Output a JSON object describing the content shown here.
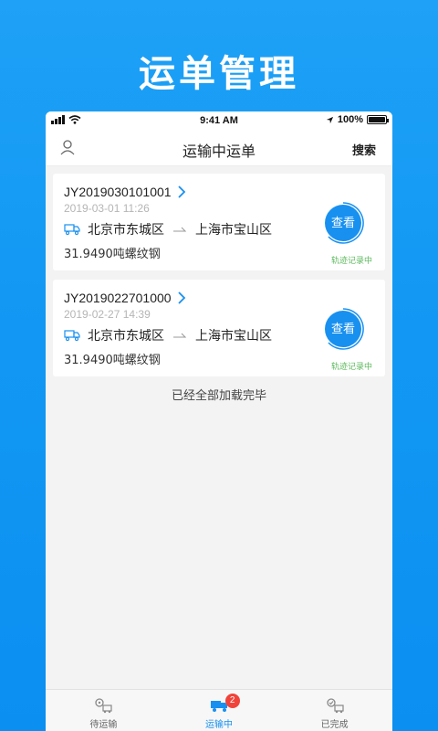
{
  "promo": {
    "title": "运单管理"
  },
  "status_bar": {
    "time": "9:41 AM",
    "battery": "100%"
  },
  "nav": {
    "title": "运输中运单",
    "search_label": "搜索"
  },
  "orders": [
    {
      "order_no": "JY2019030101001",
      "date": "2019-03-01 11:26",
      "from": "北京市东城区",
      "to": "上海市宝山区",
      "cargo": "31.9490吨螺纹钢",
      "view_label": "查看",
      "track_status": "轨迹记录中"
    },
    {
      "order_no": "JY2019022701000",
      "date": "2019-02-27 14:39",
      "from": "北京市东城区",
      "to": "上海市宝山区",
      "cargo": "31.9490吨螺纹钢",
      "view_label": "查看",
      "track_status": "轨迹记录中"
    }
  ],
  "list_footer": "已经全部加载完毕",
  "tabs": [
    {
      "label": "待运输",
      "icon": "pending-transport-icon",
      "active": false
    },
    {
      "label": "运输中",
      "icon": "truck-icon",
      "active": true,
      "badge": "2"
    },
    {
      "label": "已完成",
      "icon": "completed-icon",
      "active": false
    }
  ],
  "colors": {
    "primary": "#1890f0",
    "tracking": "#5cb85c",
    "badge": "#f0443a"
  }
}
